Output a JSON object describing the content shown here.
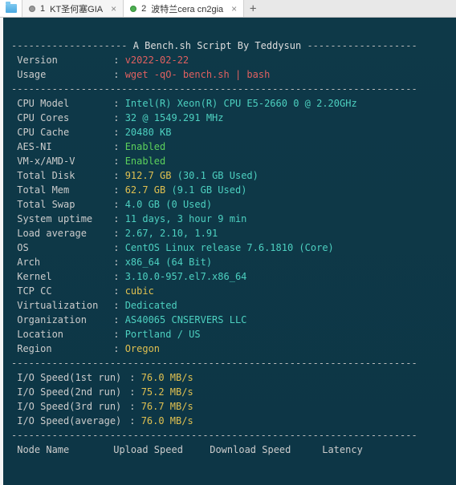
{
  "tabs": {
    "t1": {
      "index": "1",
      "label": "KT圣何塞GIA"
    },
    "t2": {
      "index": "2",
      "label": "波特兰cera cn2gia"
    }
  },
  "header": {
    "title": "A Bench.sh Script By Teddysun"
  },
  "version": {
    "label": "Version",
    "value": "v2022-02-22"
  },
  "usage": {
    "label": "Usage",
    "value": "wget -qO- bench.sh | bash"
  },
  "cpu_model": {
    "label": "CPU Model",
    "value": "Intel(R) Xeon(R) CPU E5-2660 0 @ 2.20GHz"
  },
  "cpu_cores": {
    "label": "CPU Cores",
    "value": "32 @ 1549.291 MHz"
  },
  "cpu_cache": {
    "label": "CPU Cache",
    "value": "20480 KB"
  },
  "aes_ni": {
    "label": "AES-NI",
    "value": "Enabled"
  },
  "vmx": {
    "label": "VM-x/AMD-V",
    "value": "Enabled"
  },
  "total_disk": {
    "label": "Total Disk",
    "value": "912.7 GB",
    "note": "(30.1 GB Used)"
  },
  "total_mem": {
    "label": "Total Mem",
    "value": "62.7 GB",
    "note": "(9.1 GB Used)"
  },
  "total_swap": {
    "label": "Total Swap",
    "value": "4.0 GB",
    "note": "(0 Used)"
  },
  "uptime": {
    "label": "System uptime",
    "value": "11 days, 3 hour 9 min"
  },
  "load_avg": {
    "label": "Load average",
    "value": "2.67, 2.10, 1.91"
  },
  "os": {
    "label": "OS",
    "value": "CentOS Linux release 7.6.1810 (Core)"
  },
  "arch": {
    "label": "Arch",
    "value": "x86_64",
    "note": "(64 Bit)"
  },
  "kernel": {
    "label": "Kernel",
    "value": "3.10.0-957.el7.x86_64"
  },
  "tcp_cc": {
    "label": "TCP CC",
    "value": "cubic"
  },
  "virt": {
    "label": "Virtualization",
    "value": "Dedicated"
  },
  "org": {
    "label": "Organization",
    "value": "AS40065 CNSERVERS LLC"
  },
  "location": {
    "label": "Location",
    "value": "Portland / US"
  },
  "region": {
    "label": "Region",
    "value": "Oregon"
  },
  "io1": {
    "label": "I/O Speed(1st run)",
    "value": "76.0 MB/s"
  },
  "io2": {
    "label": "I/O Speed(2nd run)",
    "value": "75.2 MB/s"
  },
  "io3": {
    "label": "I/O Speed(3rd run)",
    "value": "76.7 MB/s"
  },
  "ioavg": {
    "label": "I/O Speed(average)",
    "value": "76.0 MB/s"
  },
  "columns": {
    "node": "Node Name",
    "up": "Upload Speed",
    "down": "Download Speed",
    "lat": "Latency"
  },
  "dashes": {
    "hdr_l": "-------------------- ",
    "hdr_r": " -------------------",
    "full": "----------------------------------------------------------------------"
  }
}
